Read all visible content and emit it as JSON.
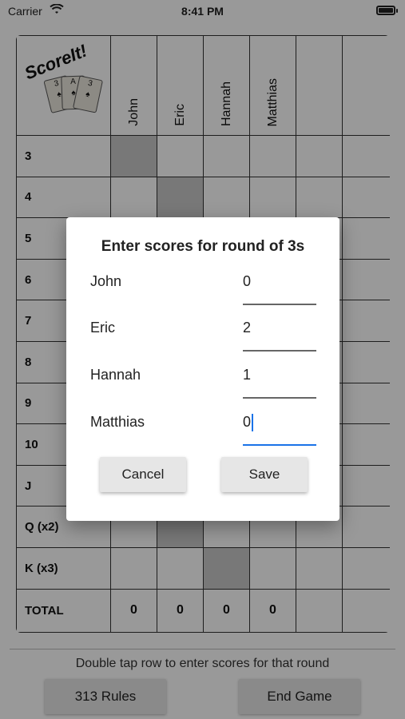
{
  "status_bar": {
    "carrier": "Carrier",
    "time": "8:41 PM"
  },
  "logo": {
    "text": "ScoreIt!",
    "cards": [
      "3",
      "A",
      "3"
    ]
  },
  "players": [
    "John",
    "Eric",
    "Hannah",
    "Matthias"
  ],
  "rounds": [
    {
      "label": "3"
    },
    {
      "label": "4"
    },
    {
      "label": "5"
    },
    {
      "label": "6"
    },
    {
      "label": "7"
    },
    {
      "label": "8"
    },
    {
      "label": "9"
    },
    {
      "label": "10"
    },
    {
      "label": "J"
    },
    {
      "label": "Q (x2)"
    },
    {
      "label": "K (x3)"
    }
  ],
  "totals": {
    "label": "TOTAL",
    "values": [
      "0",
      "0",
      "0",
      "0"
    ]
  },
  "footer": {
    "hint": "Double tap row to enter scores for that round",
    "rules_button": "313 Rules",
    "end_button": "End Game"
  },
  "dialog": {
    "title": "Enter scores for round of 3s",
    "rows": [
      {
        "name": "John",
        "value": "0"
      },
      {
        "name": "Eric",
        "value": "2"
      },
      {
        "name": "Hannah",
        "value": "1"
      },
      {
        "name": "Matthias",
        "value": "0"
      }
    ],
    "cancel_label": "Cancel",
    "save_label": "Save"
  },
  "colors": {
    "accent": "#1a73e8",
    "overlay": "rgba(0,0,0,0.4)",
    "shaded_cell": "#c9c9c9"
  },
  "icons": [
    "wifi-icon",
    "battery-icon"
  ]
}
